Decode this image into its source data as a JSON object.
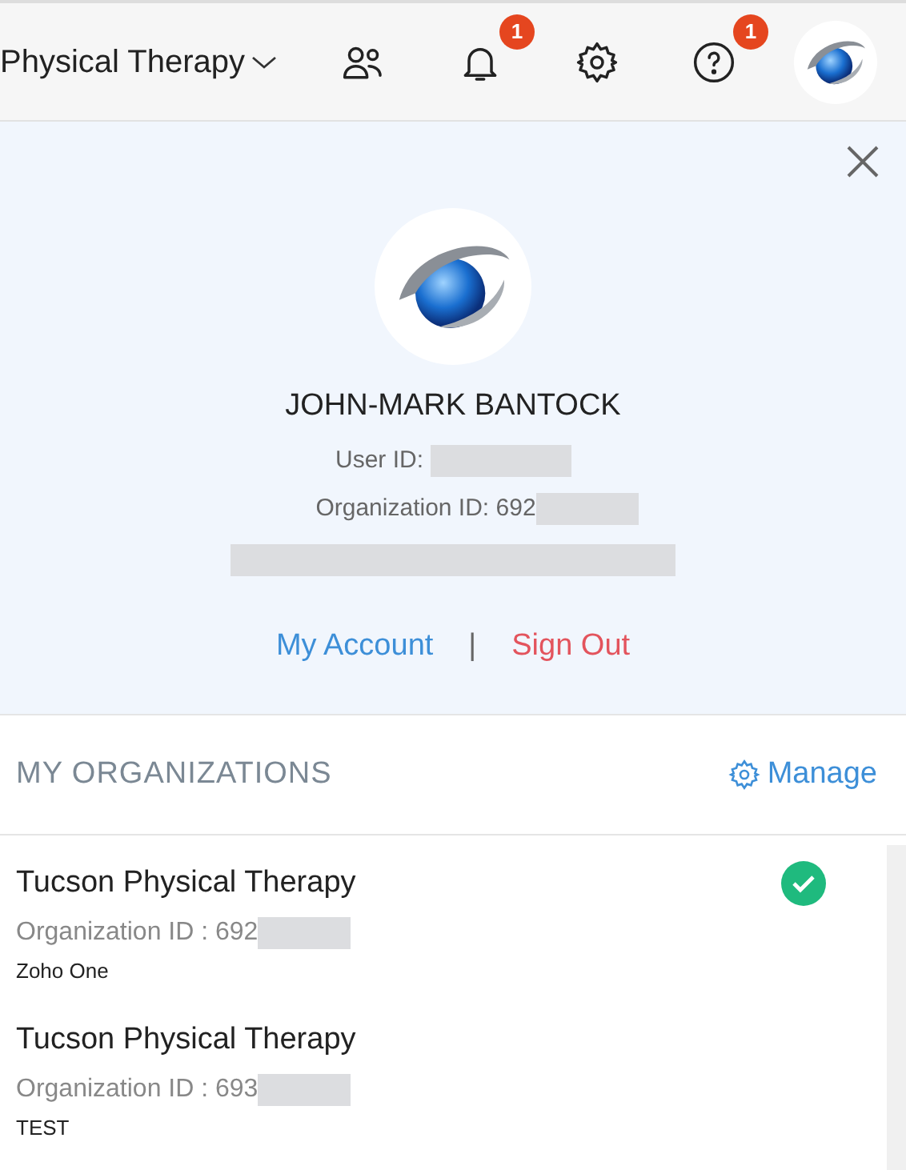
{
  "top_bar": {
    "org_name": "Physical Therapy",
    "icons": [
      {
        "kind": "users"
      },
      {
        "kind": "bell",
        "badge": "1"
      },
      {
        "kind": "gear"
      },
      {
        "kind": "help",
        "badge": "1"
      }
    ]
  },
  "profile": {
    "name": "JOHN-MARK BANTOCK",
    "user_id_label": "User ID:",
    "org_id_label": "Organization ID: 692",
    "my_account": "My Account",
    "separator": "|",
    "sign_out": "Sign Out"
  },
  "organizations": {
    "title": "MY ORGANIZATIONS",
    "manage": "Manage",
    "items": [
      {
        "name": "Tucson Physical Therapy",
        "org_id": "Organization ID : 692",
        "edition": "Zoho One",
        "selected": true
      },
      {
        "name": "Tucson Physical Therapy",
        "org_id": "Organization ID : 693",
        "edition": "TEST",
        "selected": false
      }
    ]
  }
}
